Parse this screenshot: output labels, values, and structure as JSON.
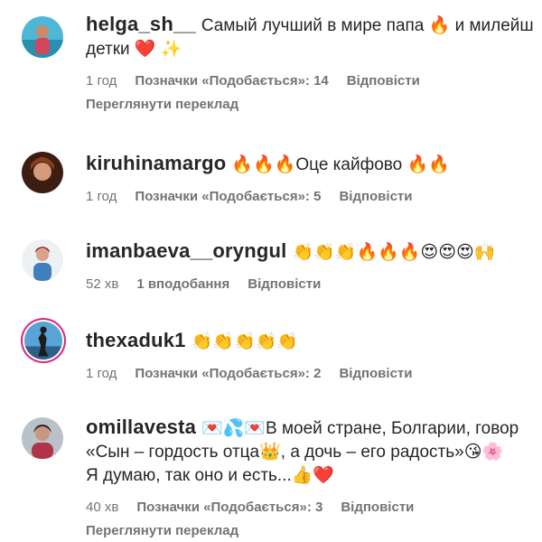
{
  "comments": [
    {
      "username": "helga_sh__",
      "lines": [
        "Самый лучший в мире папа 🔥 и милейш",
        "детки ❤️ ✨"
      ],
      "time": "1 год",
      "likes": "Позначки «Подобається»: 14",
      "reply": "Відповісти",
      "translate": "Переглянути переклад"
    },
    {
      "username": "kiruhinamargo",
      "lines": [
        "🔥🔥🔥Оце кайфово 🔥🔥"
      ],
      "time": "1 год",
      "likes": "Позначки «Подобається»: 5",
      "reply": "Відповісти"
    },
    {
      "username": "imanbaeva__oryngul",
      "lines": [
        "👏👏👏🔥🔥🔥😍😍😍🙌"
      ],
      "time": "52 хв",
      "likes": "1 вподобання",
      "reply": "Відповісти"
    },
    {
      "username": "thexaduk1",
      "lines": [
        "👏👏👏👏👏"
      ],
      "time": "1 год",
      "likes": "Позначки «Подобається»: 2",
      "reply": "Відповісти"
    },
    {
      "username": "omillavesta",
      "lines": [
        "💌💦💌В моей стране, Болгарии, говор",
        "«Сын – гордость отца👑, а дочь – его радость»😘🌸",
        "Я думаю, так оно и есть...👍❤️"
      ],
      "time": "40 хв",
      "likes": "Позначки «Подобається»: 3",
      "reply": "Відповісти",
      "translate": "Переглянути переклад"
    }
  ],
  "colors": {
    "text": "#262626",
    "meta": "#737373",
    "story_ring": "#d62976"
  }
}
